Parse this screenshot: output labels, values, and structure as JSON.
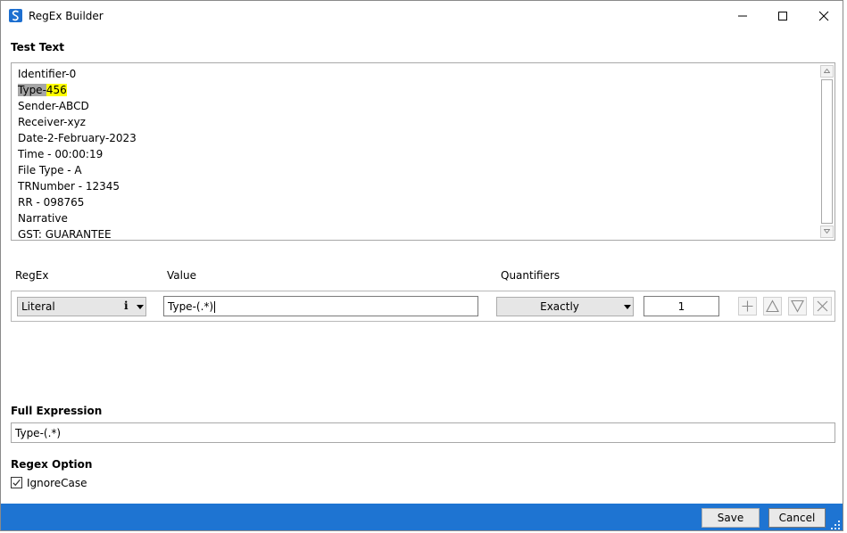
{
  "window": {
    "title": "RegEx Builder",
    "icon": "regex-app-icon",
    "controls": [
      "minimize-icon",
      "maximize-icon",
      "close-icon"
    ]
  },
  "test_text": {
    "label": "Test Text",
    "lines": [
      "Identifier-0",
      "Type-456",
      "Sender-ABCD",
      "Receiver-xyz",
      "Date-2-February-2023",
      "Time - 00:00:19",
      "File Type - A",
      "TRNumber - 12345",
      "RR - 098765",
      "Narrative",
      "GST: GUARANTEE"
    ],
    "highlight": {
      "line_index": 1,
      "match_prefix": "Type-",
      "group_text": "456",
      "match_color": "#a6a6a6",
      "group_color": "#ffff00"
    }
  },
  "columns": {
    "regex": "RegEx",
    "value": "Value",
    "quantifiers": "Quantifiers"
  },
  "row": {
    "type": "Literal",
    "info": "i",
    "value": "Type-(.*)",
    "quantifier": "Exactly",
    "count": "1",
    "actions": [
      "plus-icon",
      "move-up-icon",
      "move-down-icon",
      "delete-icon"
    ]
  },
  "full_expression": {
    "label": "Full Expression",
    "value": "Type-(.*)"
  },
  "regex_option": {
    "label": "Regex Option",
    "ignore_case_label": "IgnoreCase",
    "ignore_case_checked": true
  },
  "footer": {
    "save": "Save",
    "cancel": "Cancel",
    "color": "#1e74d2"
  }
}
